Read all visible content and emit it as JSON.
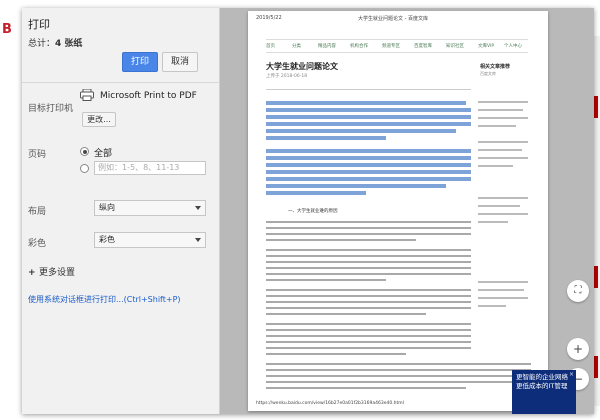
{
  "background": {
    "logo": "B"
  },
  "print_panel": {
    "title": "打印",
    "total_label": "总计：",
    "total_value": "4 张纸",
    "print_button": "打印",
    "cancel_button": "取消",
    "destination": {
      "label": "目标打印机",
      "printer_name": "Microsoft Print to PDF",
      "change_button": "更改..."
    },
    "pages": {
      "label": "页码",
      "option_all": "全部",
      "placeholder": "例如：1-5、8、11-13"
    },
    "layout": {
      "label": "布局",
      "value": "纵向"
    },
    "color": {
      "label": "彩色",
      "value": "彩色"
    },
    "more_settings": "更多设置",
    "system_dialog_link": "使用系统对话框进行打印...(Ctrl+Shift+P)"
  },
  "preview": {
    "date": "2019/5/22",
    "page_header": "大学生就业问题论文 - 百度文库",
    "nav_items": [
      "首页",
      "分类",
      "精品内容",
      "机构合作",
      "频道专区",
      "百度智库",
      "知识社区",
      "文库VIP",
      "个人中心"
    ],
    "doc_title": "大学生就业问题论文",
    "doc_meta": "上传于 2018-06-18",
    "side_title": "相关文章推荐",
    "side_subtitle": "百度文库",
    "section_heading": "一、大学生就业难的原因",
    "url": "https://wenku.baidu.com/view/16b27e0a01f2b3169a463e40.html",
    "page_number": "1/4"
  },
  "zoom": {
    "fit_icon": "⛶",
    "in_icon": "+",
    "out_icon": "−"
  },
  "ad": {
    "text": "更智能的企业网络 更低成本的IT管理",
    "close_icon": "×"
  }
}
